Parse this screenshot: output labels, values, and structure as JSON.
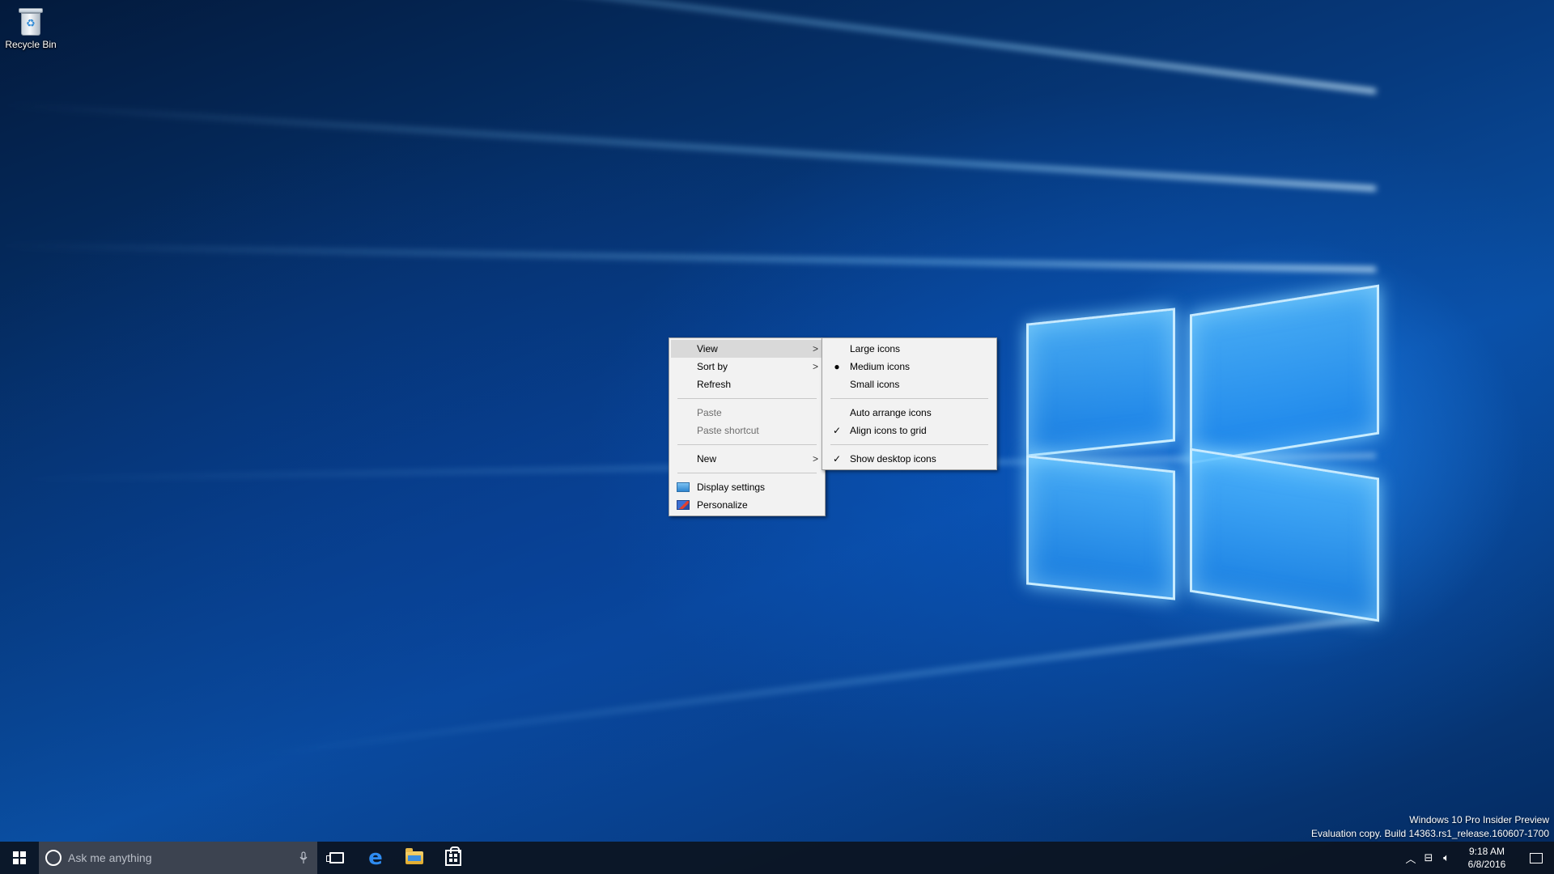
{
  "desktop": {
    "icons": [
      {
        "label": "Recycle Bin",
        "icon": "recycle-bin-icon"
      }
    ]
  },
  "context_menu": {
    "items": [
      {
        "label": "View",
        "submenu": true,
        "active": true
      },
      {
        "label": "Sort by",
        "submenu": true
      },
      {
        "label": "Refresh"
      },
      {
        "label": "Paste",
        "disabled": true
      },
      {
        "label": "Paste shortcut",
        "disabled": true
      },
      {
        "label": "New",
        "submenu": true
      },
      {
        "label": "Display settings",
        "icon": "display-settings-icon"
      },
      {
        "label": "Personalize",
        "icon": "personalize-icon"
      }
    ]
  },
  "view_submenu": {
    "items": [
      {
        "label": "Large icons"
      },
      {
        "label": "Medium icons",
        "mark": "bullet"
      },
      {
        "label": "Small icons"
      },
      {
        "label": "Auto arrange icons"
      },
      {
        "label": "Align icons to grid",
        "mark": "check"
      },
      {
        "label": "Show desktop icons",
        "mark": "check"
      }
    ]
  },
  "watermark": {
    "line1": "Windows 10 Pro Insider Preview",
    "line2": "Evaluation copy. Build 14363.rs1_release.160607-1700"
  },
  "taskbar": {
    "search_placeholder": "Ask me anything",
    "pinned": [
      "task-view-icon",
      "edge-icon",
      "file-explorer-icon",
      "store-icon"
    ],
    "clock_time": "9:18 AM",
    "clock_date": "6/8/2016"
  },
  "colors": {
    "menu_bg": "#f2f2f2",
    "menu_active": "#d9d9d9",
    "taskbar_bg": "#0c1420",
    "search_bg": "#3c4350",
    "wallpaper_accent": "#2e8bf0"
  }
}
